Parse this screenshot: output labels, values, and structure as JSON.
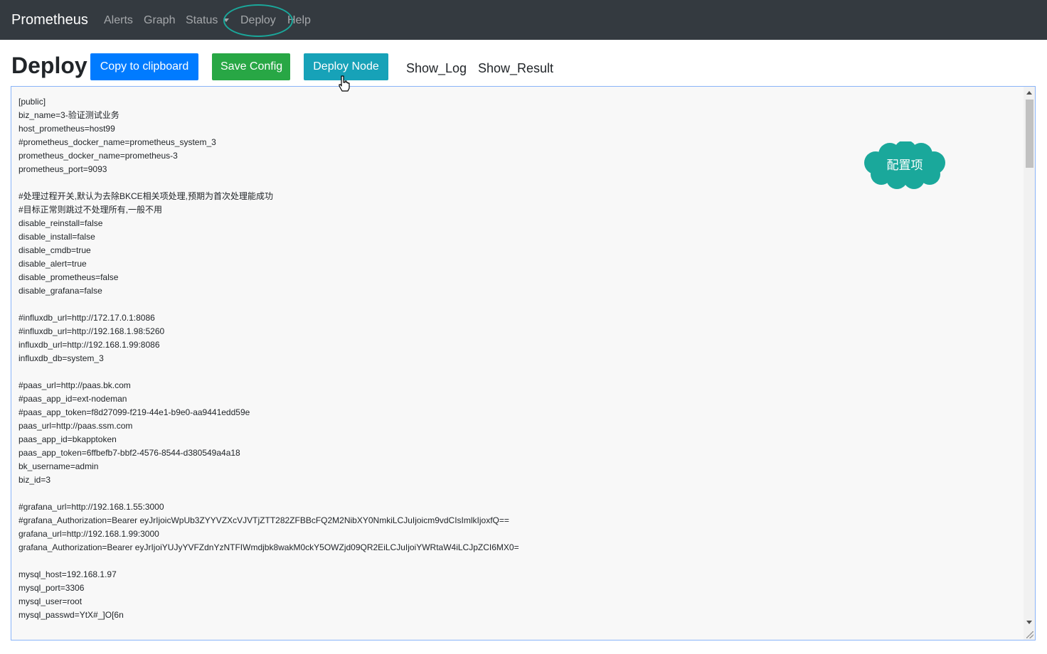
{
  "navbar": {
    "brand": "Prometheus",
    "items": [
      {
        "label": "Alerts"
      },
      {
        "label": "Graph"
      },
      {
        "label": "Status"
      },
      {
        "label": "Deploy"
      },
      {
        "label": "Help"
      }
    ]
  },
  "page": {
    "title": "Deploy",
    "buttons": {
      "copy": "Copy to clipboard",
      "save": "Save Config",
      "deploy_node": "Deploy Node"
    },
    "links": {
      "show_log": "Show_Log",
      "show_result": "Show_Result"
    }
  },
  "editor": {
    "content": "[public]\nbiz_name=3-验证测试业务\nhost_prometheus=host99\n#prometheus_docker_name=prometheus_system_3\nprometheus_docker_name=prometheus-3\nprometheus_port=9093\n\n#处理过程开关,默认为去除BKCE相关项处理,预期为首次处理能成功\n#目标正常则跳过不处理所有,一般不用\ndisable_reinstall=false\ndisable_install=false\ndisable_cmdb=true\ndisable_alert=true\ndisable_prometheus=false\ndisable_grafana=false\n\n#influxdb_url=http://172.17.0.1:8086\n#influxdb_url=http://192.168.1.98:5260\ninfluxdb_url=http://192.168.1.99:8086\ninfluxdb_db=system_3\n\n#paas_url=http://paas.bk.com\n#paas_app_id=ext-nodeman\n#paas_app_token=f8d27099-f219-44e1-b9e0-aa9441edd59e\npaas_url=http://paas.ssm.com\npaas_app_id=bkapptoken\npaas_app_token=6ffbefb7-bbf2-4576-8544-d380549a4a18\nbk_username=admin\nbiz_id=3\n\n#grafana_url=http://192.168.1.55:3000\n#grafana_Authorization=Bearer eyJrIjoicWpUb3ZYYVZXcVJVTjZTT282ZFBBcFQ2M2NibXY0NmkiLCJuIjoicm9vdCIsImlkIjoxfQ==\ngrafana_url=http://192.168.1.99:3000\ngrafana_Authorization=Bearer eyJrIjoiYUJyYVFZdnYzNTFIWmdjbk8wakM0ckY5OWZjd09QR2EiLCJuIjoiYWRtaW4iLCJpZCI6MX0=\n\nmysql_host=192.168.1.97\nmysql_port=3306\nmysql_user=root\nmysql_passwd=YtX#_]O[6n"
  },
  "annotation": {
    "cloud_label": "配置项"
  },
  "colors": {
    "navbar_bg": "#343a40",
    "copy_button": "#007bff",
    "save_button": "#28a745",
    "deploy_button": "#17a2b8",
    "cloud": "#1aa89b"
  }
}
